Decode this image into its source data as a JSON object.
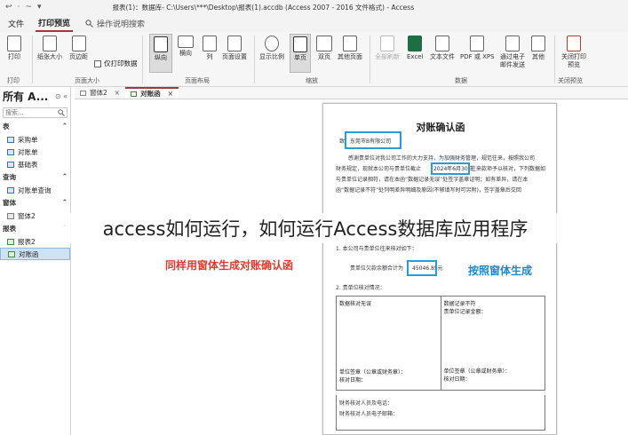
{
  "titlebar": {
    "quick_access": [
      "↩",
      "·",
      "~",
      "▾"
    ],
    "text": "报表(1)：数据库- C:\\Users\\***\\Desktop\\报表(1).accdb (Access 2007 - 2016 文件格式) - Access"
  },
  "menubar": {
    "file": "文件",
    "print_preview": "打印预览",
    "search": "操作说明搜索"
  },
  "ribbon": {
    "print": "打印",
    "paper_size": "纸张大小",
    "margins": "页边距",
    "print_data_only": "仅打印数据",
    "portrait": "纵向",
    "landscape": "横向",
    "columns": "列",
    "page_setup": "页面设置",
    "zoom": "显示比例",
    "one_page": "单页",
    "two_pages": "双页",
    "more_pages": "其他页面",
    "refresh_all": "全部刷新",
    "excel": "Excel",
    "text_file": "文本文件",
    "pdf_xps": "PDF 或 XPS",
    "email": "通过电子邮件发送",
    "more": "其他",
    "close_preview": "关闭打印预览",
    "groups": {
      "print": "打印",
      "page_size": "页面大小",
      "page_layout": "页面布局",
      "zoom": "缩放",
      "data": "数据",
      "close_preview": "关闭预览"
    }
  },
  "nav": {
    "title": "所有 A...",
    "search_placeholder": "搜索...",
    "sections": {
      "tables": "表",
      "queries": "查询",
      "forms": "窗体",
      "reports": "报表"
    },
    "tables": [
      "采购单",
      "对账单",
      "基础表"
    ],
    "queries": [
      "对账单查询"
    ],
    "forms": [
      "窗体2"
    ],
    "reports": [
      "报表2",
      "对账函"
    ]
  },
  "tabs": [
    {
      "label": "窗体2"
    },
    {
      "label": "对账函"
    }
  ],
  "doc": {
    "title": "对账确认函",
    "to_prefix": "致",
    "company": "东莞市B有限公司",
    "body_line1": "感谢贵单位对我公司工作的大力支持，为加强财务管理，规范往来，按照我公司",
    "body_line2a": "财务规定，现就本公司与贵单位截止",
    "date": "2024年6月30日",
    "body_line2b": "往来款项予以核对，下列数据如",
    "body_line3": "与贵单位记录相符，请在本函“数据记录无误”处签字盖章证明；如有差异，请在本",
    "body_line4": "函“数据记录不符”处列明差异明细及原因(不够填写时可另附)，签字盖章后交回",
    "section1": "1. 本公司与贵单位往来核对如下：",
    "balance_label": "贵单位欠款余额合计为",
    "amount": "45046.85元",
    "section2": "2. 贵单位核对情况：",
    "match_cell": "数据核对无误",
    "mismatch_cell": "数据记录不符",
    "mismatch_balance": "贵单位记录金额：",
    "sign_left": "单位签章（公章或财务章）：",
    "date_left": "核对日期：",
    "sign_right": "单位签章（公章或财务章）：",
    "date_right": "核对日期：",
    "contact_phone": "财务核对人员及电话：",
    "contact_email": "财务核对人员电子邮箱："
  },
  "annotations": {
    "blue": "按照窗体生成",
    "red": "同样用窗体生成对账确认函",
    "overlay": "access如何运行，如何运行Access数据库应用程序"
  },
  "colors": {
    "accent": "#a4373a",
    "annotation_blue": "#1a8ad0",
    "annotation_red": "#e03a2b"
  }
}
